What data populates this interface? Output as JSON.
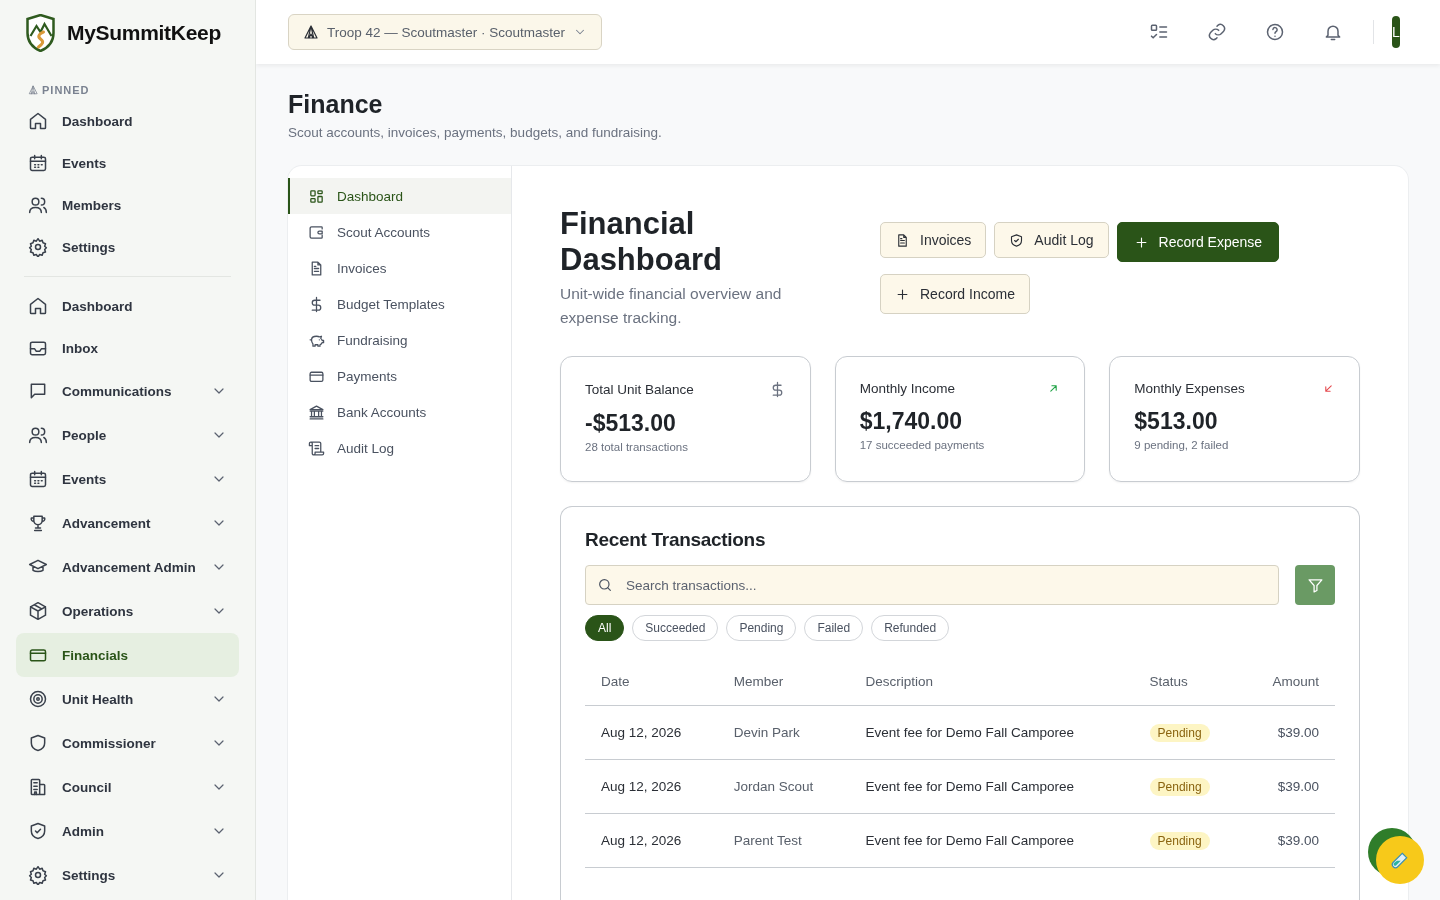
{
  "brand": {
    "name": "MySummitKeep"
  },
  "sidebar": {
    "pinned_label": "PINNED",
    "pinned": [
      {
        "label": "Dashboard"
      },
      {
        "label": "Events"
      },
      {
        "label": "Members"
      },
      {
        "label": "Settings"
      }
    ],
    "main": [
      {
        "label": "Dashboard",
        "kind": "link",
        "selected": false
      },
      {
        "label": "Inbox",
        "kind": "link",
        "selected": false
      },
      {
        "label": "Communications",
        "kind": "group",
        "selected": false
      },
      {
        "label": "People",
        "kind": "group",
        "selected": false
      },
      {
        "label": "Events",
        "kind": "group",
        "selected": false
      },
      {
        "label": "Advancement",
        "kind": "group",
        "selected": false
      },
      {
        "label": "Advancement Admin",
        "kind": "group",
        "selected": false
      },
      {
        "label": "Operations",
        "kind": "group",
        "selected": false
      },
      {
        "label": "Financials",
        "kind": "link",
        "selected": true
      },
      {
        "label": "Unit Health",
        "kind": "group",
        "selected": false
      },
      {
        "label": "Commissioner",
        "kind": "group",
        "selected": false
      },
      {
        "label": "Council",
        "kind": "group",
        "selected": false
      },
      {
        "label": "Admin",
        "kind": "group",
        "selected": false
      },
      {
        "label": "Settings",
        "kind": "group",
        "selected": false
      }
    ]
  },
  "topbar": {
    "unit_selector": "Troop 42 — Scoutmaster · Scoutmaster",
    "avatar": "L"
  },
  "page": {
    "title": "Finance",
    "subtitle": "Scout accounts, invoices, payments, budgets, and fundraising."
  },
  "subnav": [
    {
      "label": "Dashboard",
      "selected": true
    },
    {
      "label": "Scout Accounts",
      "selected": false
    },
    {
      "label": "Invoices",
      "selected": false
    },
    {
      "label": "Budget Templates",
      "selected": false
    },
    {
      "label": "Fundraising",
      "selected": false
    },
    {
      "label": "Payments",
      "selected": false
    },
    {
      "label": "Bank Accounts",
      "selected": false
    },
    {
      "label": "Audit Log",
      "selected": false
    }
  ],
  "dashboard": {
    "title": "Financial Dashboard",
    "description": "Unit-wide financial overview and expense tracking.",
    "actions": [
      {
        "label": "Invoices",
        "kind": "secondary"
      },
      {
        "label": "Audit Log",
        "kind": "secondary"
      },
      {
        "label": "Record Expense",
        "kind": "primary"
      },
      {
        "label": "Record Income",
        "kind": "secondary"
      }
    ],
    "stats": [
      {
        "label": "Total Unit Balance",
        "value": "-$513.00",
        "note": "28 total transactions"
      },
      {
        "label": "Monthly Income",
        "value": "$1,740.00",
        "note": "17 succeeded payments"
      },
      {
        "label": "Monthly Expenses",
        "value": "$513.00",
        "note": "9 pending, 2 failed"
      }
    ],
    "transactions": {
      "title": "Recent Transactions",
      "search": {
        "placeholder": "Search transactions..."
      },
      "filters": [
        {
          "label": "All",
          "selected": true
        },
        {
          "label": "Succeeded",
          "selected": false
        },
        {
          "label": "Pending",
          "selected": false
        },
        {
          "label": "Failed",
          "selected": false
        },
        {
          "label": "Refunded",
          "selected": false
        }
      ],
      "columns": [
        "Date",
        "Member",
        "Description",
        "Status",
        "Amount"
      ],
      "rows": [
        {
          "date": "Aug 12, 2026",
          "member": "Devin Park",
          "description": "Event fee for Demo Fall Camporee",
          "status": "Pending",
          "amount": "$39.00"
        },
        {
          "date": "Aug 12, 2026",
          "member": "Jordan Scout",
          "description": "Event fee for Demo Fall Camporee",
          "status": "Pending",
          "amount": "$39.00"
        },
        {
          "date": "Aug 12, 2026",
          "member": "Parent Test",
          "description": "Event fee for Demo Fall Camporee",
          "status": "Pending",
          "amount": "$39.00"
        }
      ]
    }
  }
}
